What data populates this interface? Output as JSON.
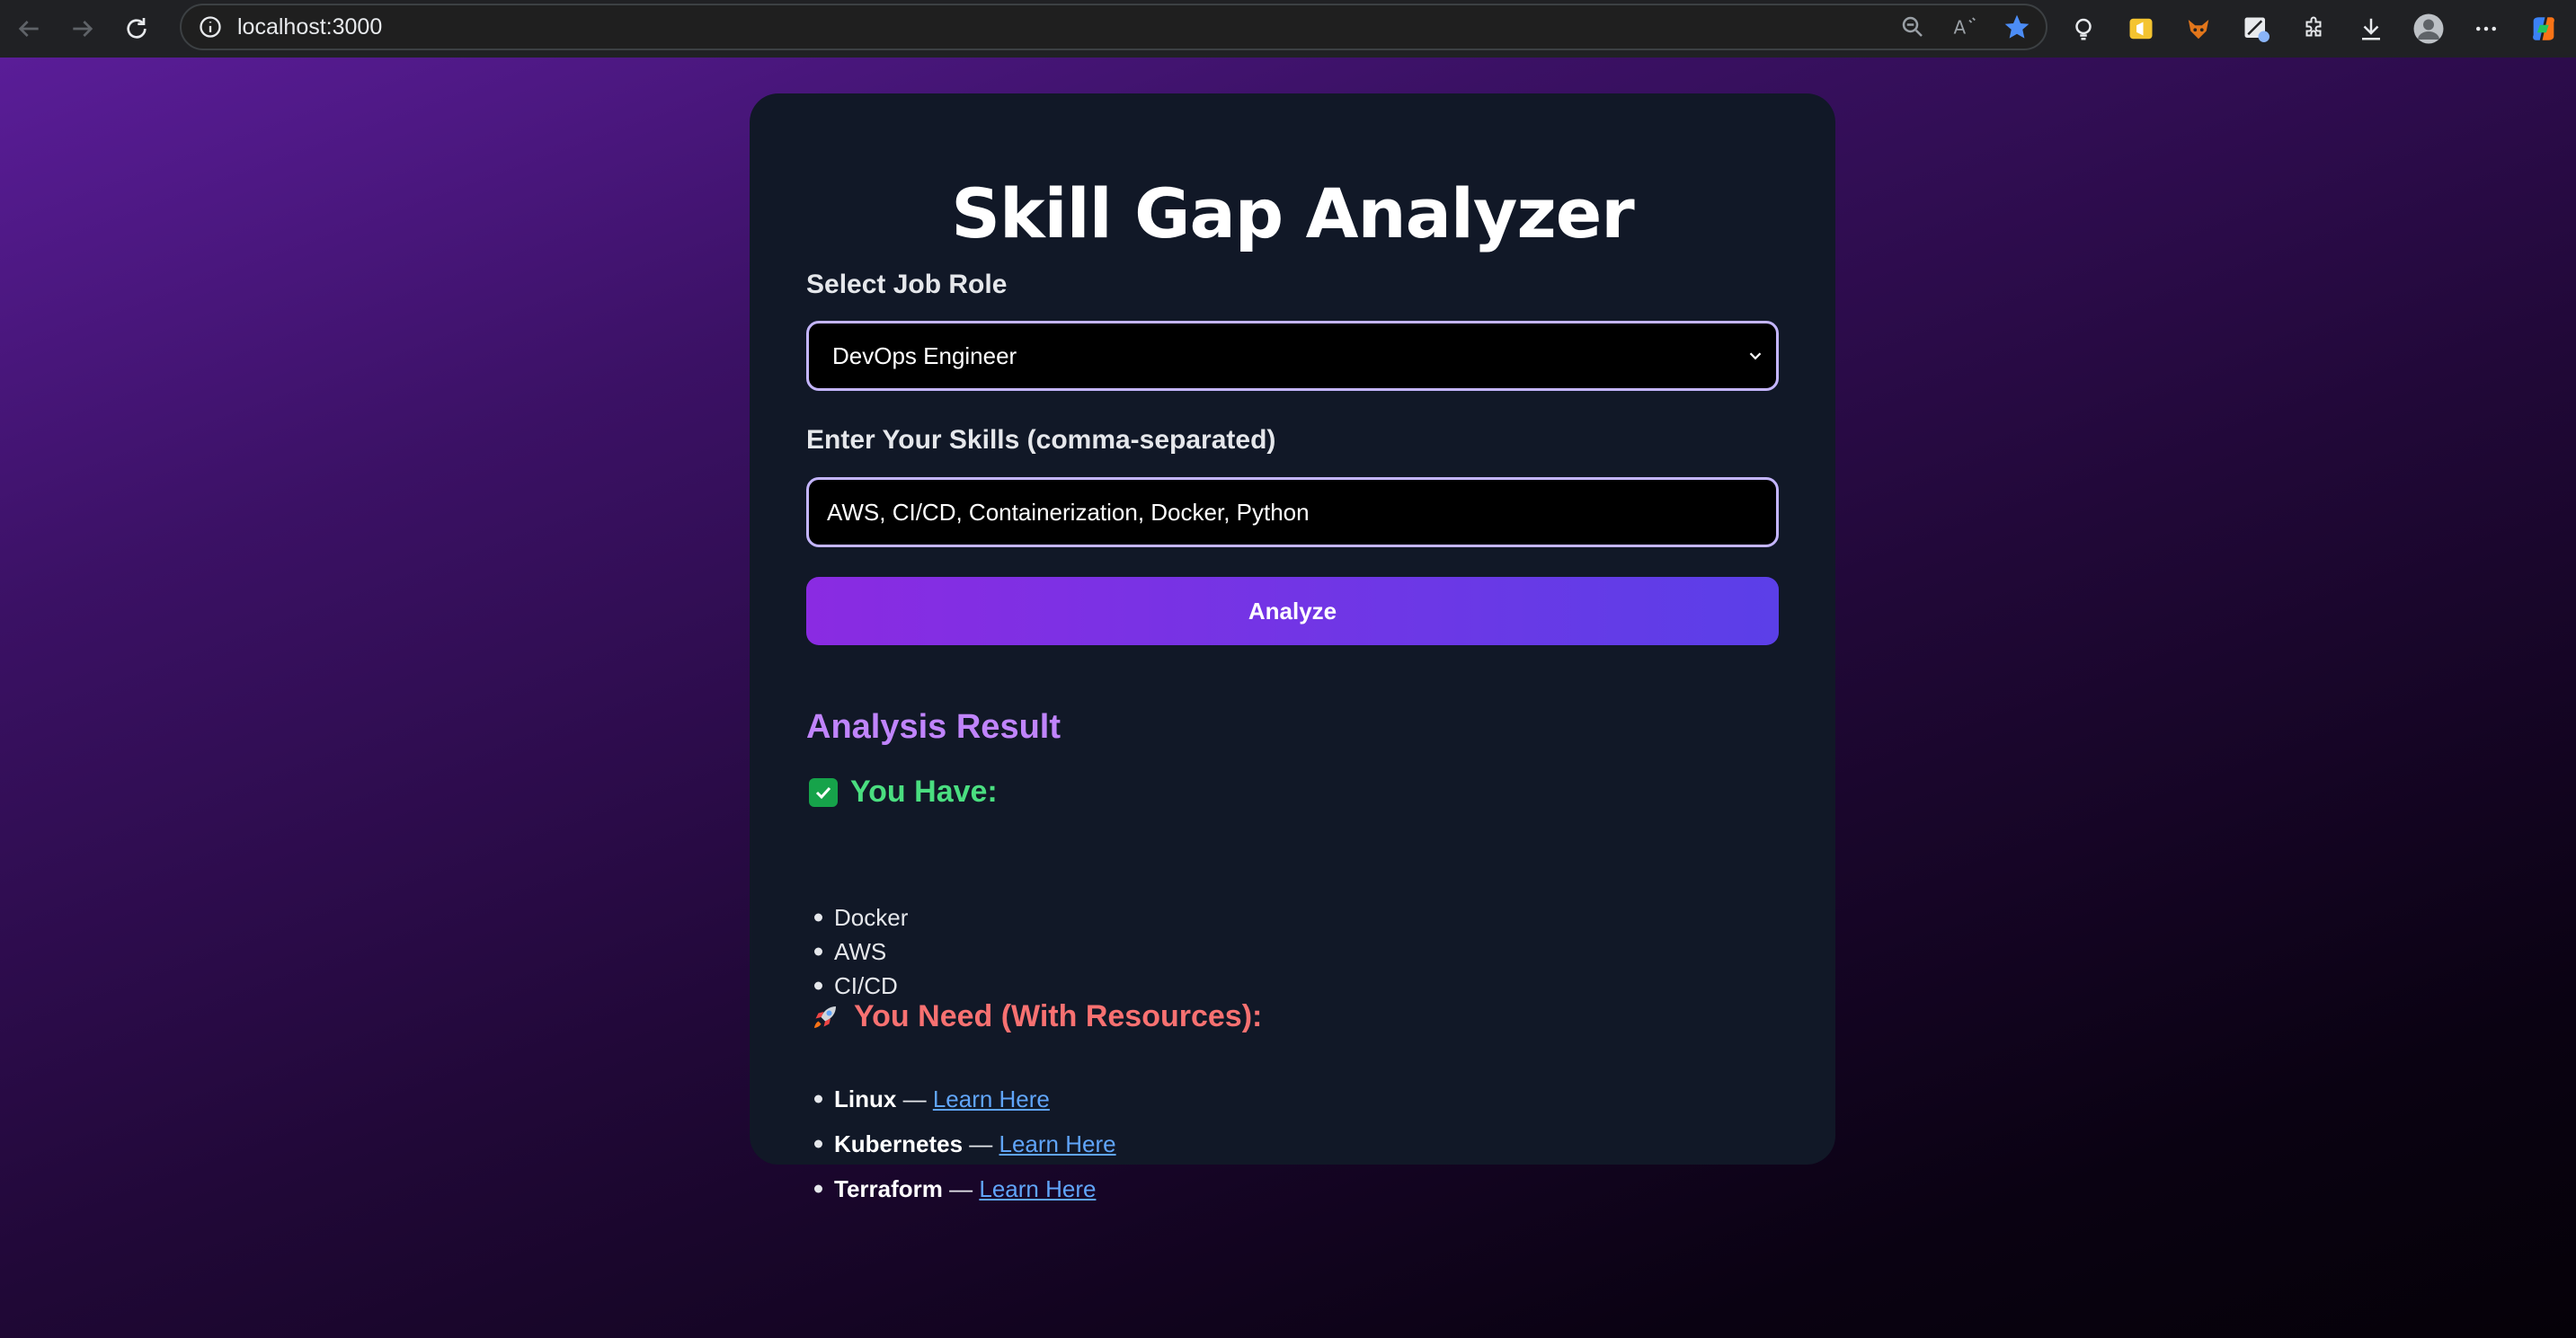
{
  "browser": {
    "url": "localhost:3000"
  },
  "app": {
    "title": "Skill Gap Analyzer",
    "job_role_label": "Select Job Role",
    "job_role_value": "DevOps Engineer",
    "skills_label": "Enter Your Skills (comma-separated)",
    "skills_value": "AWS, CI/CD, Containerization, Docker, Python",
    "analyze_button": "Analyze"
  },
  "result": {
    "title": "Analysis Result",
    "have_title": "You Have:",
    "have_items": [
      "Docker",
      "AWS",
      "CI/CD"
    ],
    "need_title": "You Need (With Resources):",
    "need_items": [
      {
        "skill": "Linux",
        "separator": "—",
        "link": "Learn Here"
      },
      {
        "skill": "Kubernetes",
        "separator": "—",
        "link": "Learn Here"
      },
      {
        "skill": "Terraform",
        "separator": "—",
        "link": "Learn Here"
      }
    ]
  },
  "colors": {
    "card_bg": "#111827",
    "accent_purple": "#c084fc",
    "have_green": "#4ade80",
    "need_red": "#f87171",
    "link_blue": "#60a5fa"
  }
}
